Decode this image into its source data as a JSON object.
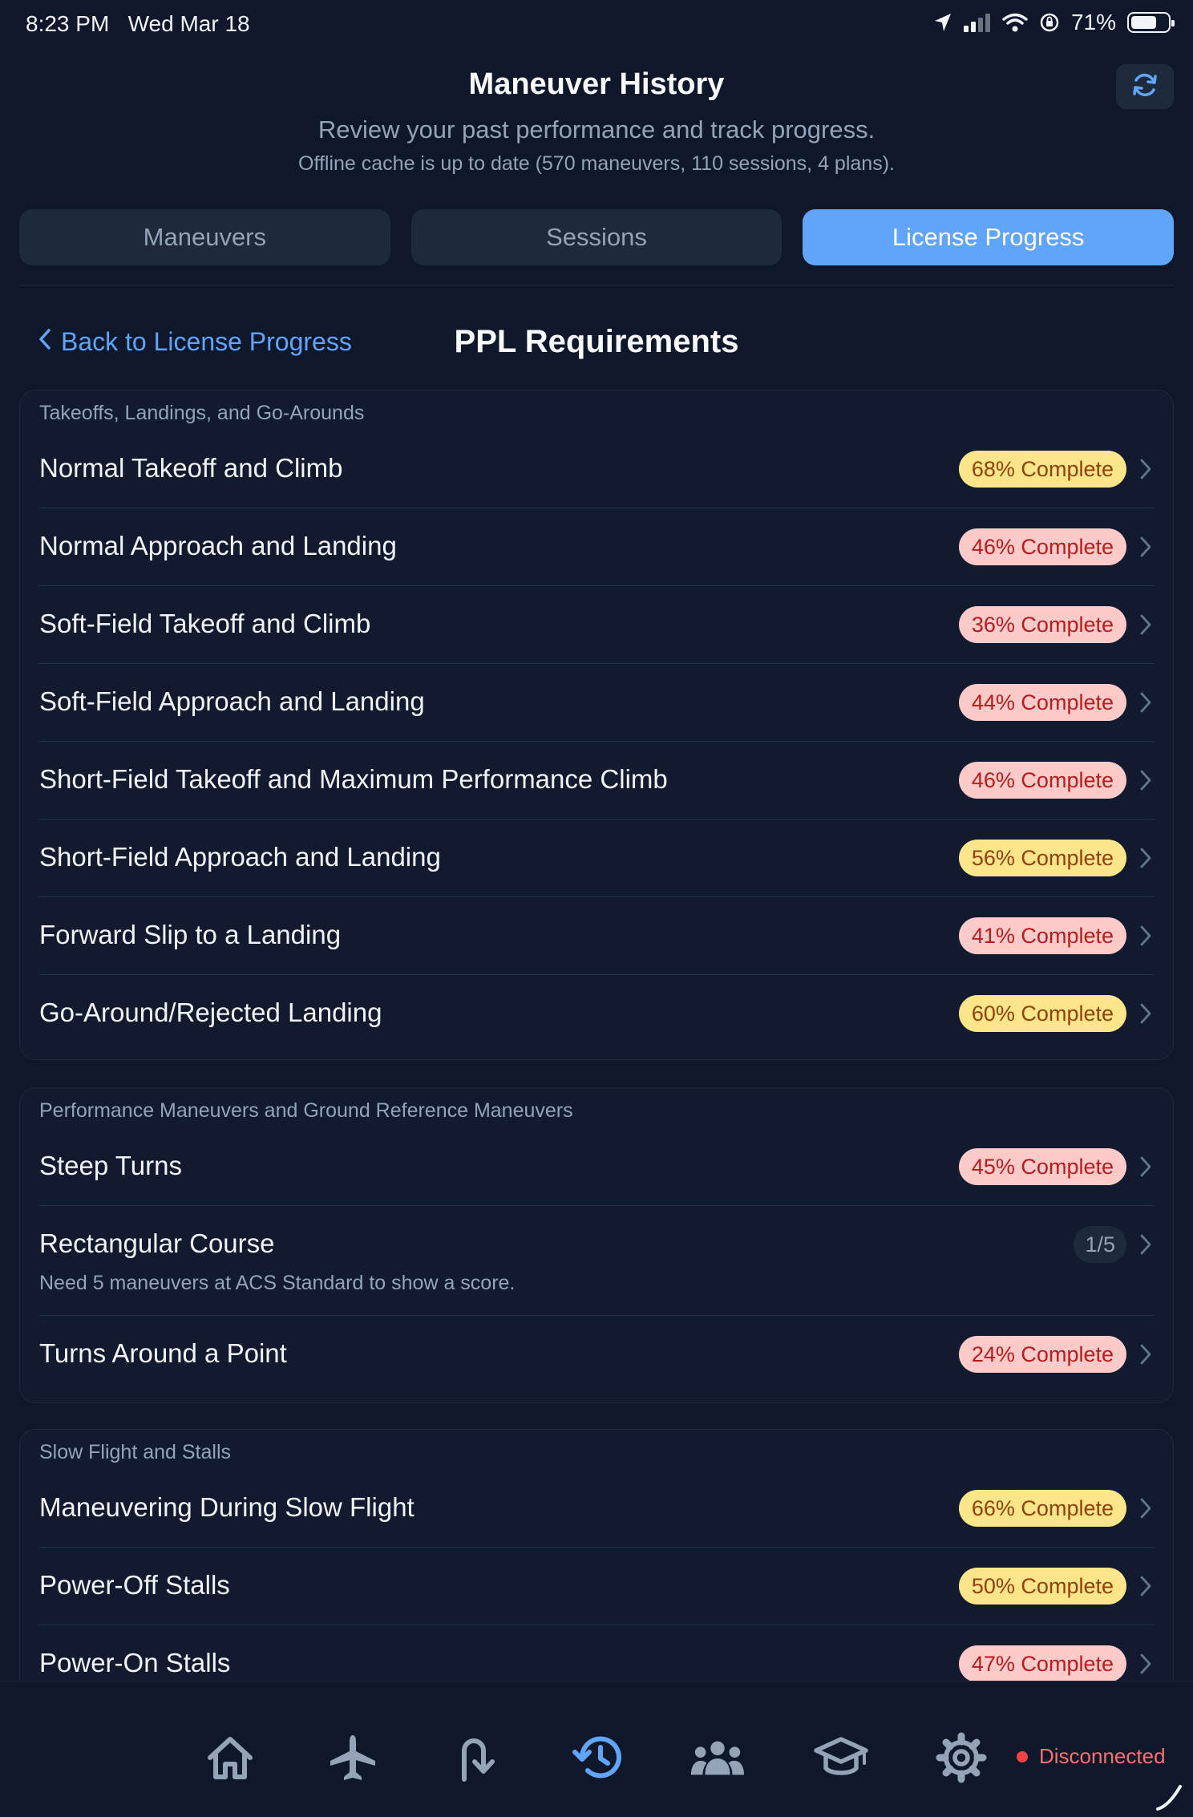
{
  "status_bar": {
    "time": "8:23 PM",
    "date": "Wed Mar 18",
    "battery": "71%"
  },
  "header": {
    "title": "Maneuver History",
    "subtitle": "Review your past performance and track progress.",
    "cache_status": "Offline cache is up to date (570 maneuvers, 110 sessions, 4 plans)."
  },
  "tabs": [
    {
      "label": "Maneuvers",
      "active": false
    },
    {
      "label": "Sessions",
      "active": false
    },
    {
      "label": "License Progress",
      "active": true
    }
  ],
  "subheader": {
    "back_label": "Back to License Progress",
    "title": "PPL Requirements"
  },
  "groups": [
    {
      "label": "Takeoffs, Landings, and Go-Arounds",
      "items": [
        {
          "name": "Normal Takeoff and Climb",
          "badge": "68% Complete",
          "progress": 68,
          "status": "yellow"
        },
        {
          "name": "Normal Approach and Landing",
          "badge": "46% Complete",
          "progress": 46,
          "status": "red"
        },
        {
          "name": "Soft-Field Takeoff and Climb",
          "badge": "36% Complete",
          "progress": 36,
          "status": "red"
        },
        {
          "name": "Soft-Field Approach and Landing",
          "badge": "44% Complete",
          "progress": 44,
          "status": "red"
        },
        {
          "name": "Short-Field Takeoff and Maximum Performance Climb",
          "badge": "46% Complete",
          "progress": 46,
          "status": "red"
        },
        {
          "name": "Short-Field Approach and Landing",
          "badge": "56% Complete",
          "progress": 56,
          "status": "yellow"
        },
        {
          "name": "Forward Slip to a Landing",
          "badge": "41% Complete",
          "progress": 41,
          "status": "red"
        },
        {
          "name": "Go-Around/Rejected Landing",
          "badge": "60% Complete",
          "progress": 60,
          "status": "yellow"
        }
      ]
    },
    {
      "label": "Performance Maneuvers and Ground Reference Maneuvers",
      "items": [
        {
          "name": "Steep Turns",
          "badge": "45% Complete",
          "progress": 45,
          "status": "red"
        },
        {
          "name": "Rectangular Course",
          "badge": "1/5",
          "status": "gray",
          "note": "Need 5 maneuvers at ACS Standard to show a score."
        },
        {
          "name": "Turns Around a Point",
          "badge": "24% Complete",
          "progress": 24,
          "status": "red"
        }
      ]
    },
    {
      "label": "Slow Flight and Stalls",
      "items": [
        {
          "name": "Maneuvering During Slow Flight",
          "badge": "66% Complete",
          "progress": 66,
          "status": "yellow"
        },
        {
          "name": "Power-Off Stalls",
          "badge": "50% Complete",
          "progress": 50,
          "status": "yellow"
        },
        {
          "name": "Power-On Stalls",
          "badge": "47% Complete",
          "progress": 47,
          "status": "red"
        }
      ]
    }
  ],
  "bottom_nav": {
    "items": [
      {
        "icon": "home-icon"
      },
      {
        "icon": "airplane-icon"
      },
      {
        "icon": "go-around-icon"
      },
      {
        "icon": "history-icon",
        "active": true
      },
      {
        "icon": "people-icon"
      },
      {
        "icon": "graduation-cap-icon"
      },
      {
        "icon": "gear-icon"
      }
    ],
    "connection_status": "Disconnected"
  },
  "colors": {
    "background": "#0f172a",
    "accent": "#60a5fa",
    "badge_yellow": "#fde68a",
    "badge_red": "#fecaca",
    "disconnected": "#ef4444"
  }
}
